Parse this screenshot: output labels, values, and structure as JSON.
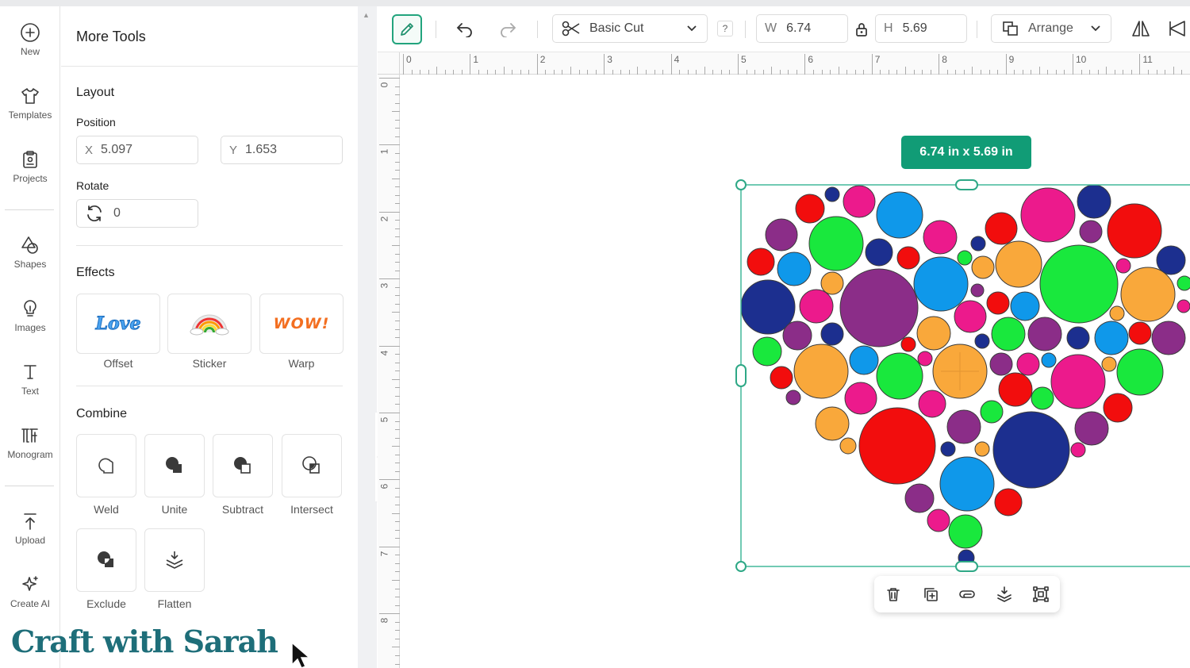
{
  "rail": {
    "items": [
      {
        "label": "New",
        "icon": "plus-circle-icon"
      },
      {
        "label": "Templates",
        "icon": "tshirt-icon"
      },
      {
        "label": "Projects",
        "icon": "clipboard-icon"
      },
      {
        "label": "Shapes",
        "icon": "shapes-icon"
      },
      {
        "label": "Images",
        "icon": "lightbulb-icon"
      },
      {
        "label": "Text",
        "icon": "text-icon"
      },
      {
        "label": "Monogram",
        "icon": "monogram-icon"
      },
      {
        "label": "Upload",
        "icon": "upload-icon"
      },
      {
        "label": "Create AI",
        "icon": "sparkle-icon"
      }
    ]
  },
  "panel": {
    "title": "More Tools",
    "layout": {
      "title": "Layout",
      "position_label": "Position",
      "x_prefix": "X",
      "x_value": "5.097",
      "y_prefix": "Y",
      "y_value": "1.653",
      "rotate_label": "Rotate",
      "rotate_value": "0"
    },
    "effects": {
      "title": "Effects",
      "items": [
        {
          "label": "Offset",
          "art": "Love"
        },
        {
          "label": "Sticker",
          "art": ""
        },
        {
          "label": "Warp",
          "art": "WOW!"
        }
      ]
    },
    "combine": {
      "title": "Combine",
      "items": [
        {
          "label": "Weld"
        },
        {
          "label": "Unite"
        },
        {
          "label": "Subtract"
        },
        {
          "label": "Intersect"
        },
        {
          "label": "Exclude"
        },
        {
          "label": "Flatten"
        }
      ]
    }
  },
  "toolbar": {
    "operation": "Basic Cut",
    "help": "?",
    "width_label": "W",
    "width_value": "6.74",
    "height_label": "H",
    "height_value": "5.69",
    "arrange_label": "Arrange"
  },
  "ruler": {
    "h": [
      "0",
      "1",
      "2",
      "3",
      "4",
      "5",
      "6",
      "7",
      "8",
      "9",
      "10",
      "11"
    ],
    "v": [
      "0",
      "1",
      "2",
      "3",
      "4",
      "5",
      "6",
      "7",
      "8"
    ]
  },
  "selection": {
    "size_badge": "6.74  in x 5.69  in"
  },
  "watermark": "Craft with Sarah",
  "colors": {
    "accent": "#119c76",
    "brand": "#1e6e79",
    "red": "#f20d0d",
    "green": "#19e83d",
    "blue": "#0f98ea",
    "navy": "#1c2f8f",
    "purple": "#8b2d88",
    "pink": "#ec1a8c",
    "orange": "#f9a83b"
  }
}
